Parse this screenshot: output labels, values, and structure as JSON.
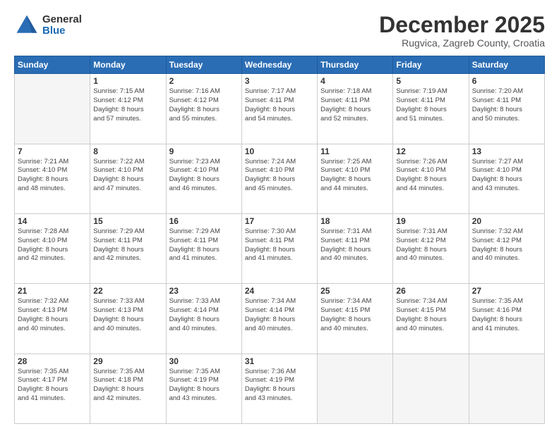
{
  "header": {
    "logo_general": "General",
    "logo_blue": "Blue",
    "month": "December 2025",
    "location": "Rugvica, Zagreb County, Croatia"
  },
  "weekdays": [
    "Sunday",
    "Monday",
    "Tuesday",
    "Wednesday",
    "Thursday",
    "Friday",
    "Saturday"
  ],
  "weeks": [
    [
      {
        "day": "",
        "info": ""
      },
      {
        "day": "1",
        "info": "Sunrise: 7:15 AM\nSunset: 4:12 PM\nDaylight: 8 hours\nand 57 minutes."
      },
      {
        "day": "2",
        "info": "Sunrise: 7:16 AM\nSunset: 4:12 PM\nDaylight: 8 hours\nand 55 minutes."
      },
      {
        "day": "3",
        "info": "Sunrise: 7:17 AM\nSunset: 4:11 PM\nDaylight: 8 hours\nand 54 minutes."
      },
      {
        "day": "4",
        "info": "Sunrise: 7:18 AM\nSunset: 4:11 PM\nDaylight: 8 hours\nand 52 minutes."
      },
      {
        "day": "5",
        "info": "Sunrise: 7:19 AM\nSunset: 4:11 PM\nDaylight: 8 hours\nand 51 minutes."
      },
      {
        "day": "6",
        "info": "Sunrise: 7:20 AM\nSunset: 4:11 PM\nDaylight: 8 hours\nand 50 minutes."
      }
    ],
    [
      {
        "day": "7",
        "info": "Sunrise: 7:21 AM\nSunset: 4:10 PM\nDaylight: 8 hours\nand 48 minutes."
      },
      {
        "day": "8",
        "info": "Sunrise: 7:22 AM\nSunset: 4:10 PM\nDaylight: 8 hours\nand 47 minutes."
      },
      {
        "day": "9",
        "info": "Sunrise: 7:23 AM\nSunset: 4:10 PM\nDaylight: 8 hours\nand 46 minutes."
      },
      {
        "day": "10",
        "info": "Sunrise: 7:24 AM\nSunset: 4:10 PM\nDaylight: 8 hours\nand 45 minutes."
      },
      {
        "day": "11",
        "info": "Sunrise: 7:25 AM\nSunset: 4:10 PM\nDaylight: 8 hours\nand 44 minutes."
      },
      {
        "day": "12",
        "info": "Sunrise: 7:26 AM\nSunset: 4:10 PM\nDaylight: 8 hours\nand 44 minutes."
      },
      {
        "day": "13",
        "info": "Sunrise: 7:27 AM\nSunset: 4:10 PM\nDaylight: 8 hours\nand 43 minutes."
      }
    ],
    [
      {
        "day": "14",
        "info": "Sunrise: 7:28 AM\nSunset: 4:10 PM\nDaylight: 8 hours\nand 42 minutes."
      },
      {
        "day": "15",
        "info": "Sunrise: 7:29 AM\nSunset: 4:11 PM\nDaylight: 8 hours\nand 42 minutes."
      },
      {
        "day": "16",
        "info": "Sunrise: 7:29 AM\nSunset: 4:11 PM\nDaylight: 8 hours\nand 41 minutes."
      },
      {
        "day": "17",
        "info": "Sunrise: 7:30 AM\nSunset: 4:11 PM\nDaylight: 8 hours\nand 41 minutes."
      },
      {
        "day": "18",
        "info": "Sunrise: 7:31 AM\nSunset: 4:11 PM\nDaylight: 8 hours\nand 40 minutes."
      },
      {
        "day": "19",
        "info": "Sunrise: 7:31 AM\nSunset: 4:12 PM\nDaylight: 8 hours\nand 40 minutes."
      },
      {
        "day": "20",
        "info": "Sunrise: 7:32 AM\nSunset: 4:12 PM\nDaylight: 8 hours\nand 40 minutes."
      }
    ],
    [
      {
        "day": "21",
        "info": "Sunrise: 7:32 AM\nSunset: 4:13 PM\nDaylight: 8 hours\nand 40 minutes."
      },
      {
        "day": "22",
        "info": "Sunrise: 7:33 AM\nSunset: 4:13 PM\nDaylight: 8 hours\nand 40 minutes."
      },
      {
        "day": "23",
        "info": "Sunrise: 7:33 AM\nSunset: 4:14 PM\nDaylight: 8 hours\nand 40 minutes."
      },
      {
        "day": "24",
        "info": "Sunrise: 7:34 AM\nSunset: 4:14 PM\nDaylight: 8 hours\nand 40 minutes."
      },
      {
        "day": "25",
        "info": "Sunrise: 7:34 AM\nSunset: 4:15 PM\nDaylight: 8 hours\nand 40 minutes."
      },
      {
        "day": "26",
        "info": "Sunrise: 7:34 AM\nSunset: 4:15 PM\nDaylight: 8 hours\nand 40 minutes."
      },
      {
        "day": "27",
        "info": "Sunrise: 7:35 AM\nSunset: 4:16 PM\nDaylight: 8 hours\nand 41 minutes."
      }
    ],
    [
      {
        "day": "28",
        "info": "Sunrise: 7:35 AM\nSunset: 4:17 PM\nDaylight: 8 hours\nand 41 minutes."
      },
      {
        "day": "29",
        "info": "Sunrise: 7:35 AM\nSunset: 4:18 PM\nDaylight: 8 hours\nand 42 minutes."
      },
      {
        "day": "30",
        "info": "Sunrise: 7:35 AM\nSunset: 4:19 PM\nDaylight: 8 hours\nand 43 minutes."
      },
      {
        "day": "31",
        "info": "Sunrise: 7:36 AM\nSunset: 4:19 PM\nDaylight: 8 hours\nand 43 minutes."
      },
      {
        "day": "",
        "info": ""
      },
      {
        "day": "",
        "info": ""
      },
      {
        "day": "",
        "info": ""
      }
    ]
  ]
}
